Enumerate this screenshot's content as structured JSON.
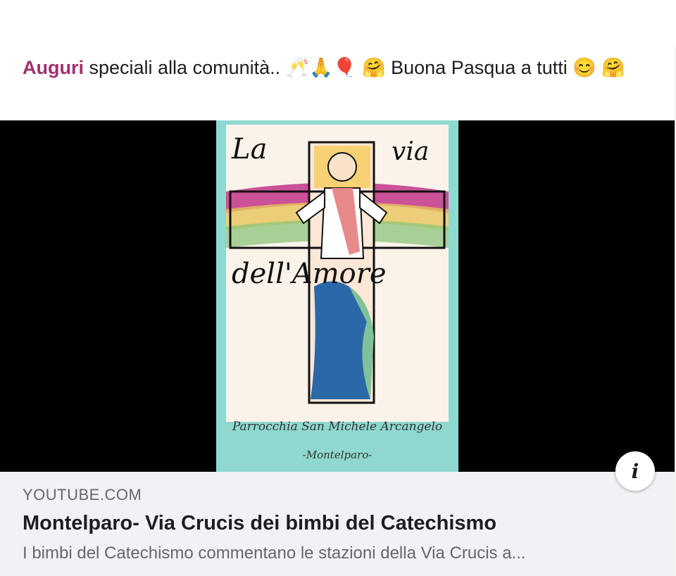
{
  "post": {
    "hashtag": "Auguri",
    "text_rest": " speciali alla comunità.. 🥂🙏🎈 🤗 Buona Pasqua a tutti 😊 🤗"
  },
  "video": {
    "poster_title_line1": "La",
    "poster_title_line2": "via",
    "poster_title_line3": "dell'Amore",
    "poster_caption_line1": "Parrocchia San Michele Arcangelo",
    "poster_caption_line2": "-Montelparo-",
    "info_icon": "i"
  },
  "link": {
    "domain": "YOUTUBE.COM",
    "title": "Montelparo- Via Crucis dei bimbi del Catechismo",
    "description": "I bimbi del Catechismo commentano le stazioni della Via Crucis a..."
  }
}
